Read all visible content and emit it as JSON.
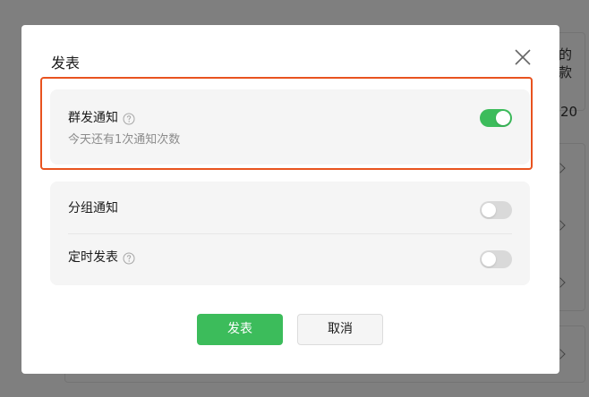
{
  "background": {
    "snippet_1": "的",
    "snippet_2": "款",
    "snippet_3": "20"
  },
  "dialog": {
    "title": "发表",
    "close_icon": "close-icon",
    "mass_notify": {
      "label": "群发通知",
      "help_icon": "question-circle-icon",
      "subtext": "今天还有1次通知次数",
      "enabled": true
    },
    "group_notify": {
      "label": "分组通知",
      "enabled": false
    },
    "scheduled_publish": {
      "label": "定时发表",
      "help_icon": "question-circle-icon",
      "enabled": false
    },
    "publish_button": "发表",
    "cancel_button": "取消"
  },
  "colors": {
    "accent": "#3cbc5b",
    "highlight": "#e8531f",
    "toggle_off": "#d9d9d9",
    "panel": "#f5f5f5"
  }
}
